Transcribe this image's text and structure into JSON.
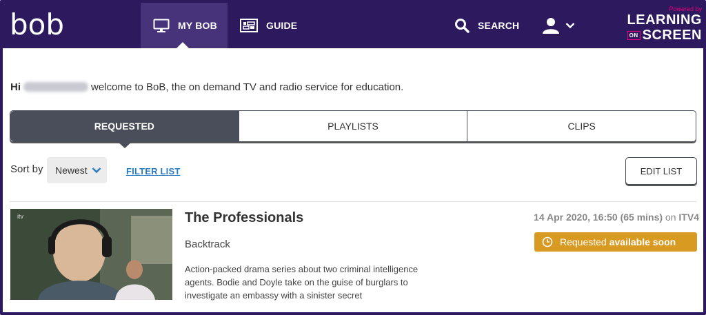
{
  "header": {
    "logo": "bob",
    "nav": [
      {
        "label": "MY BOB",
        "icon": "monitor-icon"
      },
      {
        "label": "GUIDE",
        "icon": "guide-icon"
      }
    ],
    "search_label": "SEARCH",
    "brand": {
      "powered": "Powered by",
      "line1": "LEARNING",
      "on": "ON",
      "line2": "SCREEN"
    },
    "colors": {
      "background": "#2d1a5e",
      "active": "#47337a",
      "accent": "#e6007e"
    }
  },
  "greeting": {
    "hi": "Hi",
    "message": "welcome to BoB, the on demand TV and radio service for education."
  },
  "tabs": [
    {
      "label": "REQUESTED",
      "active": true
    },
    {
      "label": "PLAYLISTS",
      "active": false
    },
    {
      "label": "CLIPS",
      "active": false
    }
  ],
  "sort": {
    "label": "Sort by",
    "selected": "Newest",
    "filter_label": "FILTER LIST",
    "edit_label": "EDIT LIST"
  },
  "item": {
    "title": "The Professionals",
    "subtitle": "Backtrack",
    "description": "Action-packed drama series about two criminal intelligence agents. Bodie and Doyle take on the guise of burglars to investigate an embassy with a sinister secret",
    "date": "14 Apr 2020, 16:50 (65 mins)",
    "on_text": "on",
    "channel": "ITV4",
    "status_prefix": "Requested",
    "status_bold": "available soon",
    "status_color": "#d99a22"
  }
}
